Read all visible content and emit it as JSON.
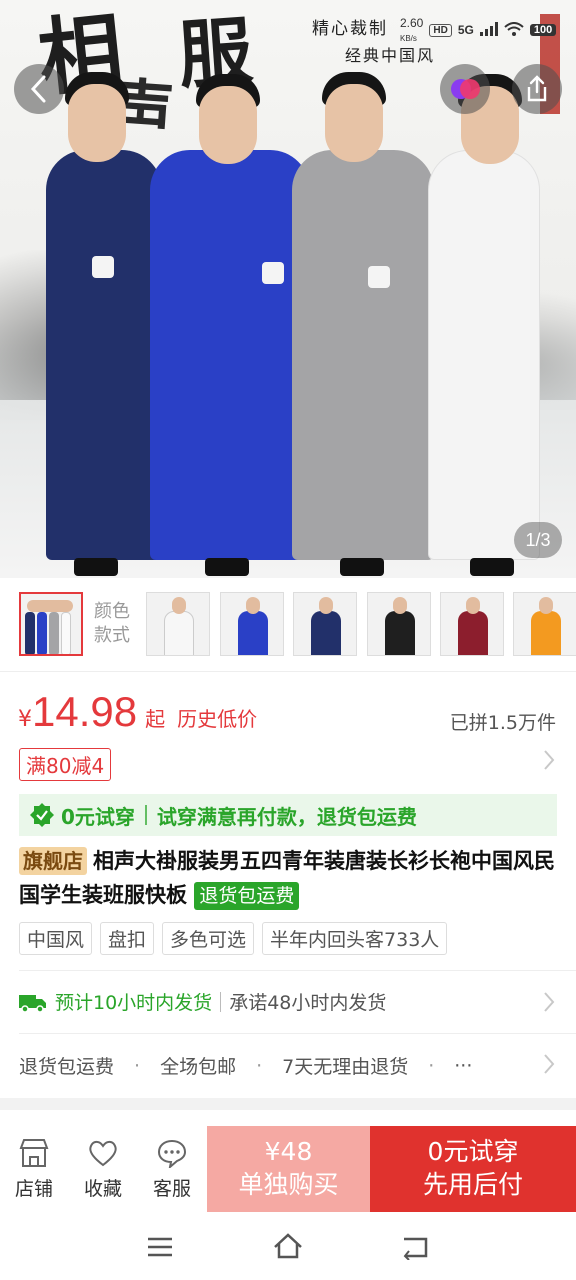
{
  "status_bar": {
    "speed": "2.60",
    "speed_unit": "KB/s",
    "hd": "HD",
    "network": "5G",
    "battery": "100"
  },
  "hero": {
    "calligraphy": [
      "相",
      "声",
      "服"
    ],
    "slogan_line1": "精心裁制",
    "slogan_line2": "经典中国风",
    "counter": "1/3",
    "robe_colors": [
      "#22306a",
      "#2a40c6",
      "#a4a4a6",
      "#f4f4f4"
    ]
  },
  "thumbnails": {
    "color_label": "颜色\n款式",
    "items": [
      {
        "name": "多色",
        "color": "multi"
      },
      {
        "name": "白色",
        "color": "#f7f7f7"
      },
      {
        "name": "蓝色",
        "color": "#2a40c6"
      },
      {
        "name": "藏青",
        "color": "#22306a"
      },
      {
        "name": "黑色",
        "color": "#1f1f1f"
      },
      {
        "name": "酒红",
        "color": "#8c1e2d"
      },
      {
        "name": "橙色",
        "color": "#f39a20"
      }
    ]
  },
  "price": {
    "symbol": "¥",
    "value": "14.98",
    "suffix": "起",
    "tag": "历史低价",
    "sold": "已拼1.5万件"
  },
  "coupon": "满80减4",
  "trial": {
    "label": "0元试穿",
    "desc": "试穿满意再付款，退货包运费"
  },
  "product": {
    "badge": "旗舰店",
    "title": "相声大褂服装男五四青年装唐装长衫长袍中国风民国学生装班服快板",
    "return_badge": "退货包运费"
  },
  "tags": [
    "中国风",
    "盘扣",
    "多色可选",
    "半年内回头客733人"
  ],
  "shipping": {
    "estimate": "预计10小时内发货",
    "promise": "承诺48小时内发货"
  },
  "services": [
    "退货包运费",
    "全场包邮",
    "7天无理由退货",
    "···"
  ],
  "bottom_bar": {
    "store": "店铺",
    "favorite": "收藏",
    "service": "客服",
    "single_price": "¥48",
    "single_label": "单独购买",
    "trial_line1": "0元试穿",
    "trial_line2": "先用后付"
  },
  "colors": {
    "accent_red": "#e4393c",
    "accent_green": "#2aa52a",
    "buy_single_bg": "#f5a9a3",
    "buy_trial_bg": "#e0322e"
  }
}
